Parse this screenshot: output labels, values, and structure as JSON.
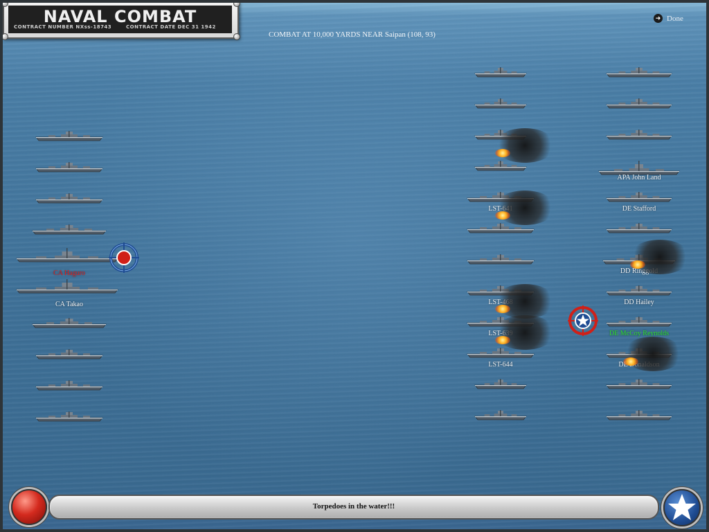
{
  "header": {
    "title": "NAVAL COMBAT",
    "contract_number": "CONTRACT NUMBER  NXss-18743",
    "contract_date": "CONTRACT DATE  DEC 31 1942",
    "done_label": "Done",
    "combat_text": "COMBAT AT 10,000 YARDS NEAR Saipan (108, 93)"
  },
  "status": {
    "message": "Torpedoes in the water!!!"
  },
  "colors": {
    "sea": "#3f7198",
    "ship_hull": "#4e5a66",
    "enemy_label": "#e02020",
    "selected_label": "#2fe02f",
    "reticle_red": "#d02018",
    "reticle_blue": "#1f4c93"
  },
  "icons": {
    "done": "arrow-right-circle-icon",
    "enemy_target": "target-reticle-icon",
    "allied_target": "star-reticle-icon",
    "fire_button": "red-button-icon",
    "star_button": "us-star-icon"
  },
  "japanese_fleet": [
    {
      "label": ""
    },
    {
      "label": ""
    },
    {
      "label": ""
    },
    {
      "label": ""
    },
    {
      "label": "CA Haguro",
      "state": "targeted"
    },
    {
      "label": "CA Takao"
    },
    {
      "label": ""
    },
    {
      "label": ""
    },
    {
      "label": ""
    },
    {
      "label": ""
    }
  ],
  "allied_fleet": {
    "column_left": [
      {
        "label": ""
      },
      {
        "label": ""
      },
      {
        "label": ""
      },
      {
        "label": "",
        "state": "burning"
      },
      {
        "label": "LST-641"
      },
      {
        "label": "",
        "state": "burning"
      },
      {
        "label": ""
      },
      {
        "label": "LST-468"
      },
      {
        "label": "LST-639",
        "state": "burning"
      },
      {
        "label": "LST-644",
        "state": "burning"
      },
      {
        "label": ""
      },
      {
        "label": ""
      }
    ],
    "column_right": [
      {
        "label": ""
      },
      {
        "label": ""
      },
      {
        "label": ""
      },
      {
        "label": "APA John Land"
      },
      {
        "label": "DE Stafford"
      },
      {
        "label": ""
      },
      {
        "label": "DD Ringgold",
        "state": "burning"
      },
      {
        "label": "DD Hailey"
      },
      {
        "label": "DE McCoy Reynolds",
        "state": "selected"
      },
      {
        "label": "DE Donaldson",
        "state": "burning"
      },
      {
        "label": ""
      },
      {
        "label": ""
      }
    ]
  }
}
